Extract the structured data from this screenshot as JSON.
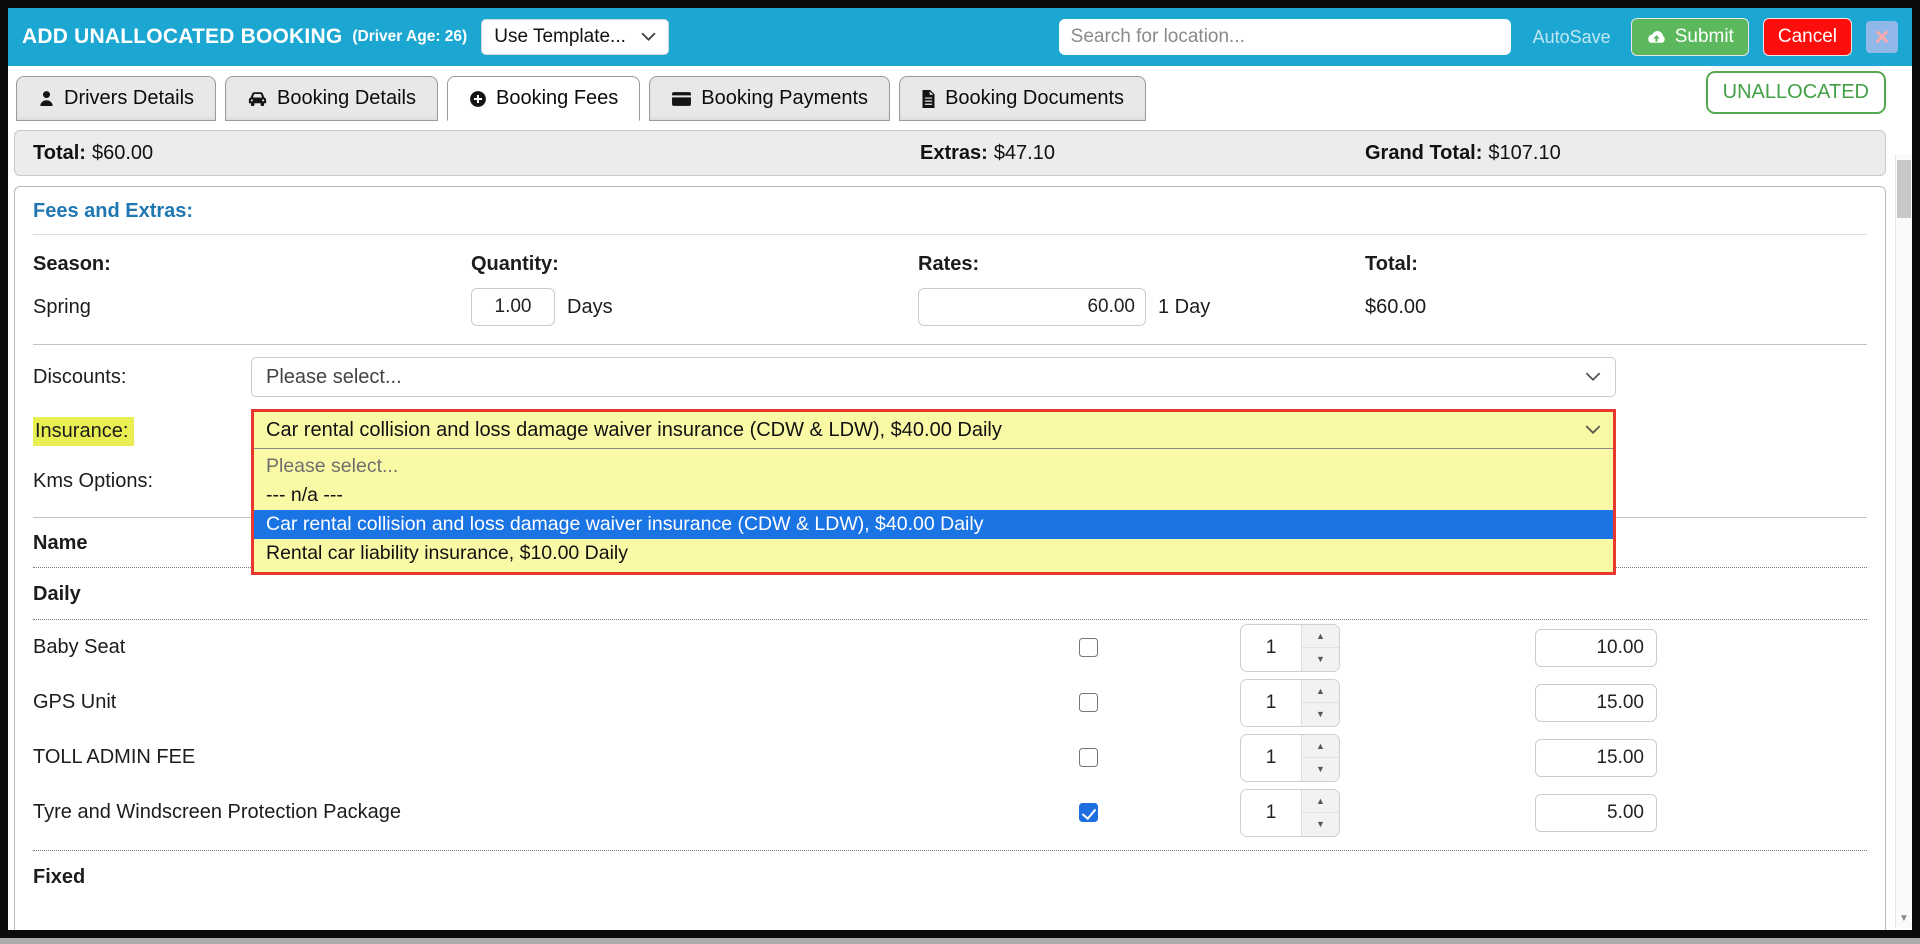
{
  "header": {
    "title": "ADD UNALLOCATED BOOKING",
    "driver_age_note": "(Driver Age: 26)",
    "template_select_value": "Use Template...",
    "search_placeholder": "Search for location...",
    "autosave_label": "AutoSave",
    "submit_label": "Submit",
    "cancel_label": "Cancel"
  },
  "tabs": {
    "items": [
      {
        "label": "Drivers Details",
        "icon": "user-icon",
        "active": false
      },
      {
        "label": "Booking Details",
        "icon": "car-icon",
        "active": false
      },
      {
        "label": "Booking Fees",
        "icon": "plus-circle-icon",
        "active": true
      },
      {
        "label": "Booking Payments",
        "icon": "credit-card-icon",
        "active": false
      },
      {
        "label": "Booking Documents",
        "icon": "document-icon",
        "active": false
      }
    ],
    "status_badge": "UNALLOCATED"
  },
  "totals_bar": {
    "total_label": "Total:",
    "total_value": "$60.00",
    "extras_label": "Extras:",
    "extras_value": "$47.10",
    "grand_total_label": "Grand Total:",
    "grand_total_value": "$107.10"
  },
  "fees_section": {
    "heading": "Fees and Extras:",
    "columns": {
      "season": "Season:",
      "quantity": "Quantity:",
      "rates": "Rates:",
      "total": "Total:"
    },
    "season_row": {
      "season": "Spring",
      "quantity_value": "1.00",
      "quantity_unit": "Days",
      "rate_value": "60.00",
      "rate_unit": "1 Day",
      "total": "$60.00"
    }
  },
  "discounts": {
    "label": "Discounts:",
    "selected": "Please select..."
  },
  "insurance": {
    "label": "Insurance:",
    "selected": "Car rental collision and loss damage waiver insurance (CDW & LDW), $40.00 Daily",
    "options": [
      {
        "label": "Please select...",
        "state": "placeholder"
      },
      {
        "label": "--- n/a ---",
        "state": "normal"
      },
      {
        "label": "Car rental collision and loss damage waiver insurance (CDW & LDW), $40.00 Daily",
        "state": "highlighted"
      },
      {
        "label": "Rental car liability insurance, $10.00 Daily",
        "state": "normal"
      }
    ]
  },
  "kms_options": {
    "label": "Kms Options:"
  },
  "extras_table": {
    "name_header": "Name",
    "daily_section_title": "Daily",
    "fixed_section_title": "Fixed",
    "daily_items": [
      {
        "name": "Baby Seat",
        "checked": false,
        "qty": "1",
        "price": "10.00"
      },
      {
        "name": "GPS Unit",
        "checked": false,
        "qty": "1",
        "price": "15.00"
      },
      {
        "name": "TOLL ADMIN FEE",
        "checked": false,
        "qty": "1",
        "price": "15.00"
      },
      {
        "name": "Tyre and Windscreen Protection Package",
        "checked": true,
        "qty": "1",
        "price": "5.00"
      }
    ]
  },
  "colors": {
    "header_blue": "#1BA7D2",
    "submit_green": "#5CB85C",
    "cancel_red": "#FE0D0D",
    "close_button_blue": "#8FB8E8",
    "badge_green": "#56A74F",
    "heading_blue": "#2077B2",
    "label_highlight_yellow": "#E9EF52",
    "dropdown_yellow": "#FAFAA6",
    "alert_border_red": "#E8382D",
    "selected_option_blue": "#1B74E4",
    "checkbox_checked_blue": "#1E6FE0"
  }
}
